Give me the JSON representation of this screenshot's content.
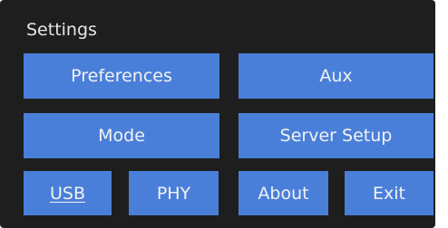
{
  "panel": {
    "title": "Settings"
  },
  "buttons": {
    "preferences": "Preferences",
    "aux": "Aux",
    "mode": "Mode",
    "server_setup": "Server Setup",
    "usb": "USB",
    "phy": "PHY",
    "about": "About",
    "exit": "Exit"
  },
  "colors": {
    "panel_background": "#1e1e1e",
    "button_background": "#4a7fd9",
    "text": "#f2f2f2"
  }
}
